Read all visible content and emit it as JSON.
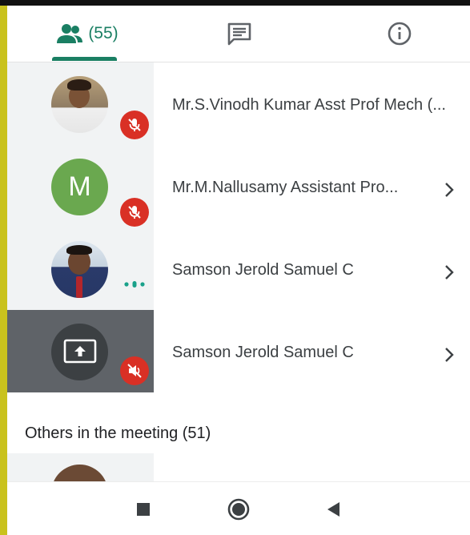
{
  "tabs": {
    "people_count": "(55)",
    "accent_color": "#1a7f63",
    "icons": [
      "people-icon",
      "chat-icon",
      "info-icon"
    ]
  },
  "participants": [
    {
      "name": "Mr.S.Vinodh Kumar Asst Prof Mech (...",
      "muted": true,
      "avatar": "photo"
    },
    {
      "name": "Mr.M.Nallusamy Assistant Pro...",
      "muted": true,
      "avatar_letter": "M"
    },
    {
      "name": "Samson Jerold Samuel C",
      "speaking": true,
      "avatar": "photo"
    },
    {
      "name": "Samson Jerold Samuel C",
      "presenting": true,
      "audio_muted": true
    }
  ],
  "others": {
    "label": "Others in the meeting (51)"
  },
  "colors": {
    "mute_badge": "#d93025",
    "avatar_green": "#6aa84f"
  },
  "navbar": {
    "icons": [
      "recents-icon",
      "home-icon",
      "back-icon"
    ]
  }
}
